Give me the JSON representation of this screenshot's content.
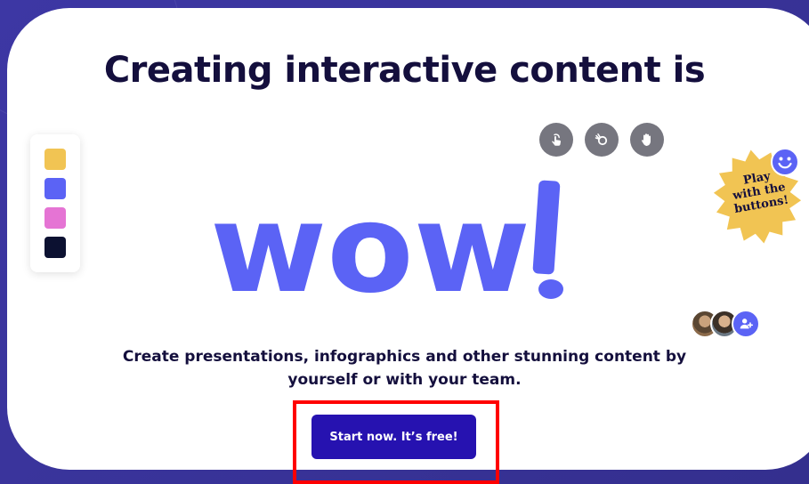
{
  "hero": {
    "headline": "Creating interactive content is",
    "big_word": "wow!",
    "subtitle_line1": "Create presentations, infographics and other stunning content by",
    "subtitle_line2": "yourself or with your team.",
    "cta_label": "Start now. It’s free!"
  },
  "tools": [
    {
      "name": "tap-icon"
    },
    {
      "name": "animate-icon"
    },
    {
      "name": "hand-icon"
    }
  ],
  "palette": {
    "colors": [
      "#f1c453",
      "#5b63f5",
      "#e574d4",
      "#0c1131"
    ]
  },
  "sticker": {
    "text": "Play\nwith the\nbuttons!",
    "color": "#f1c453",
    "icon": "smiley-icon"
  },
  "collaborators": {
    "icon": "add-user-icon"
  },
  "colors": {
    "accent": "#5b63f5",
    "cta": "#2612b0",
    "headline": "#140f3d",
    "background": "#3a3499"
  }
}
